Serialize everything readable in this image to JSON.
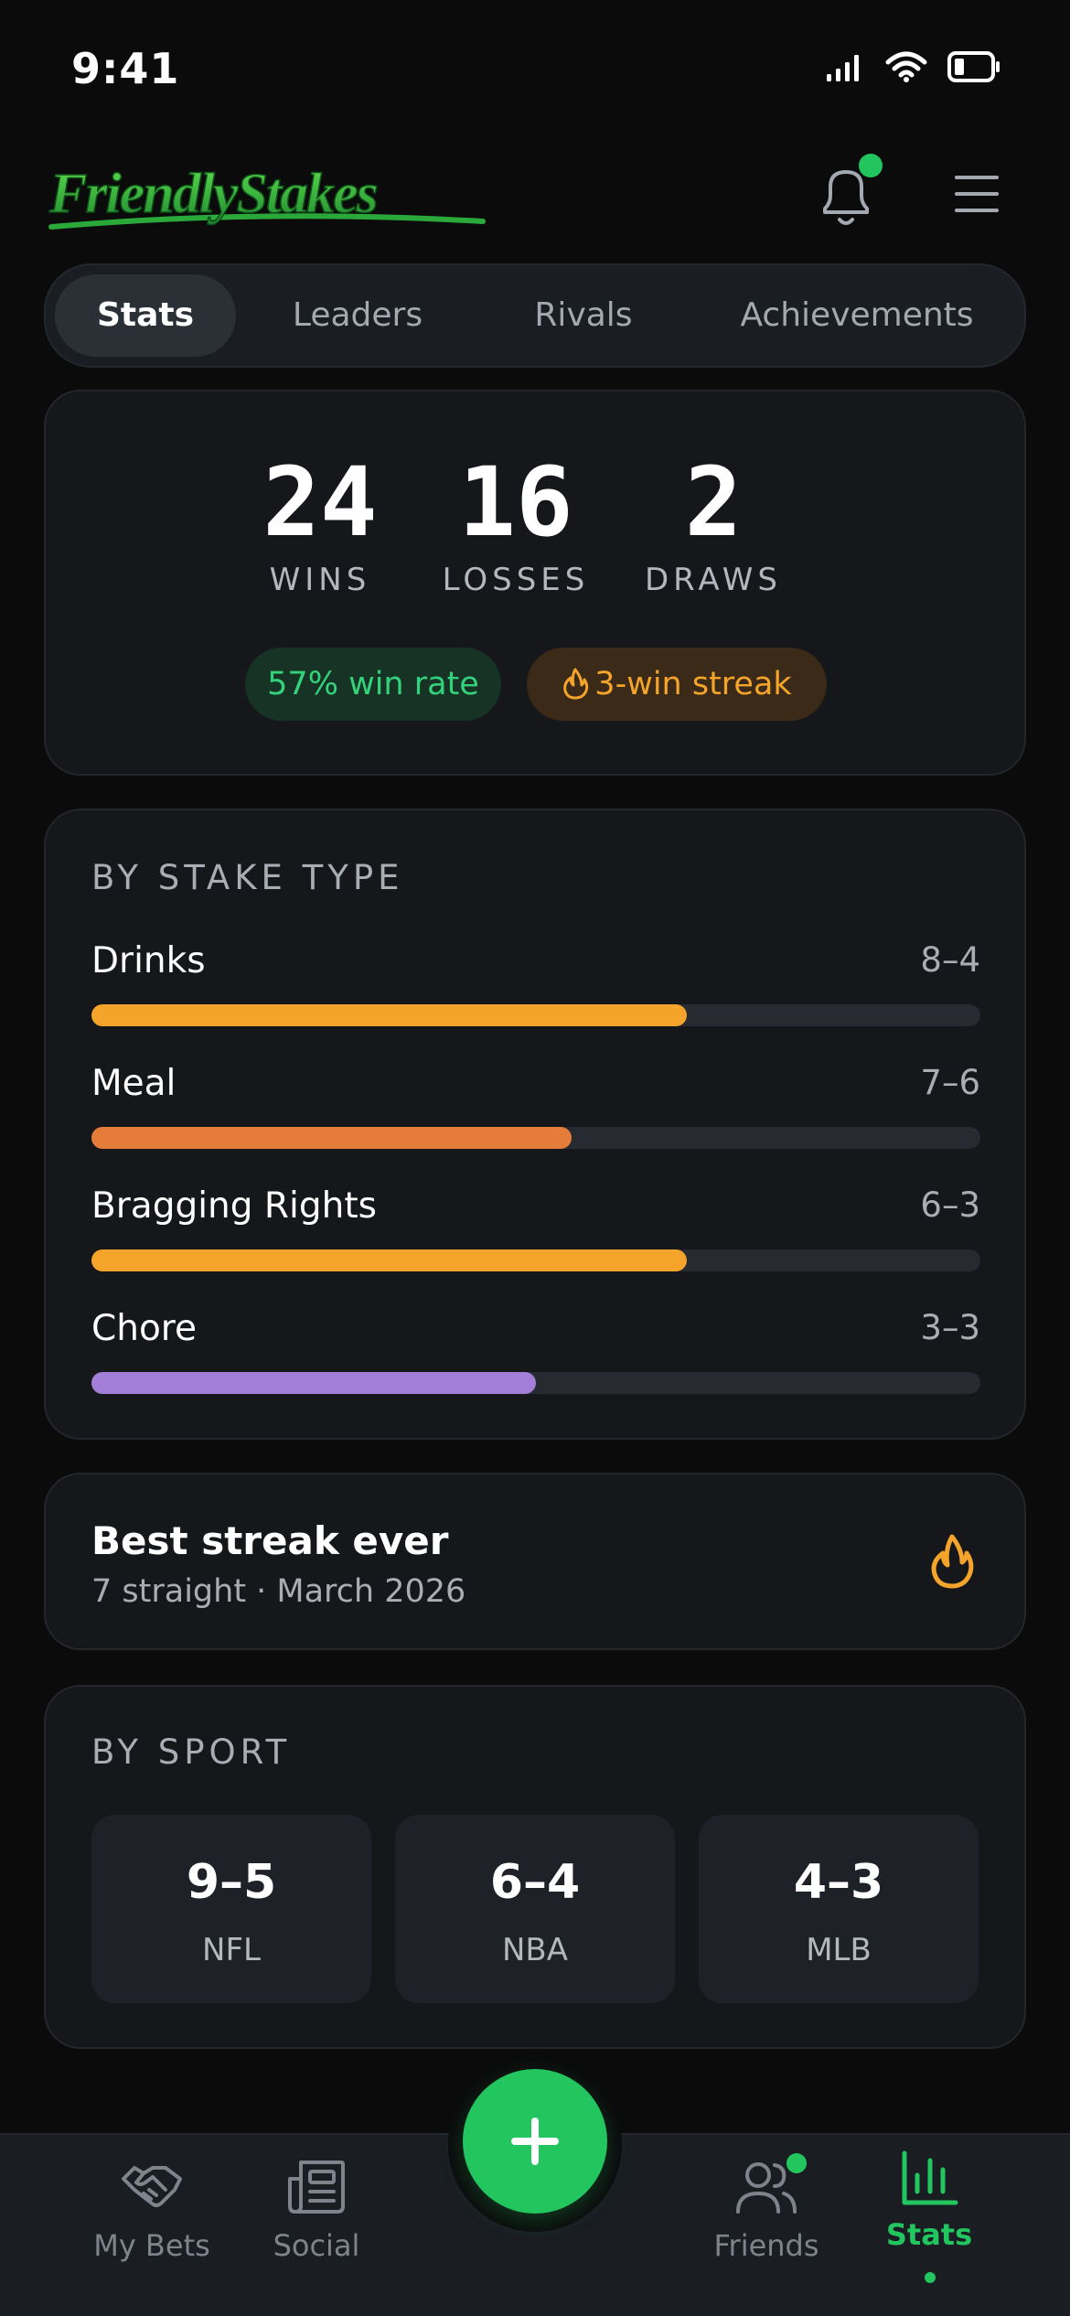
{
  "status_bar": {
    "time": "9:41"
  },
  "header": {
    "logo_text": "FriendlyStakes",
    "has_notification": true
  },
  "tabs": [
    {
      "label": "Stats",
      "active": true
    },
    {
      "label": "Leaders",
      "active": false
    },
    {
      "label": "Rivals",
      "active": false
    },
    {
      "label": "Achievements",
      "active": false
    }
  ],
  "record": {
    "wins": "24",
    "wins_label": "WINS",
    "losses": "16",
    "losses_label": "LOSSES",
    "draws": "2",
    "draws_label": "DRAWS",
    "win_rate": "57% win rate",
    "streak": "3-win streak"
  },
  "by_stake": {
    "title": "BY STAKE TYPE",
    "rows": [
      {
        "label": "Drinks",
        "record": "8–4",
        "win_fraction": 0.67,
        "color": "#f4a42b"
      },
      {
        "label": "Meal",
        "record": "7–6",
        "win_fraction": 0.54,
        "color": "#e57c3a"
      },
      {
        "label": "Bragging Rights",
        "record": "6–3",
        "win_fraction": 0.67,
        "color": "#f4a42b"
      },
      {
        "label": "Chore",
        "record": "3–3",
        "win_fraction": 0.5,
        "color": "#a37fd9"
      }
    ]
  },
  "best_streak": {
    "title": "Best streak ever",
    "subtitle": "7 straight · March 2026"
  },
  "by_sport": {
    "title": "BY SPORT",
    "items": [
      {
        "record": "9–5",
        "sport": "NFL"
      },
      {
        "record": "6–4",
        "sport": "NBA"
      },
      {
        "record": "4–3",
        "sport": "MLB"
      }
    ]
  },
  "nav": {
    "items": [
      {
        "label": "My Bets",
        "icon": "handshake-icon",
        "active": false
      },
      {
        "label": "Social",
        "icon": "newspaper-icon",
        "active": false
      },
      {
        "label": "Friends",
        "icon": "users-icon",
        "active": false
      },
      {
        "label": "Stats",
        "icon": "bar-chart-icon",
        "active": true
      }
    ],
    "fab_icon": "plus-icon"
  },
  "colors": {
    "accent": "#22c55e",
    "orange": "#f4a42b",
    "background": "#0b0b0c",
    "card": "#15171b"
  }
}
